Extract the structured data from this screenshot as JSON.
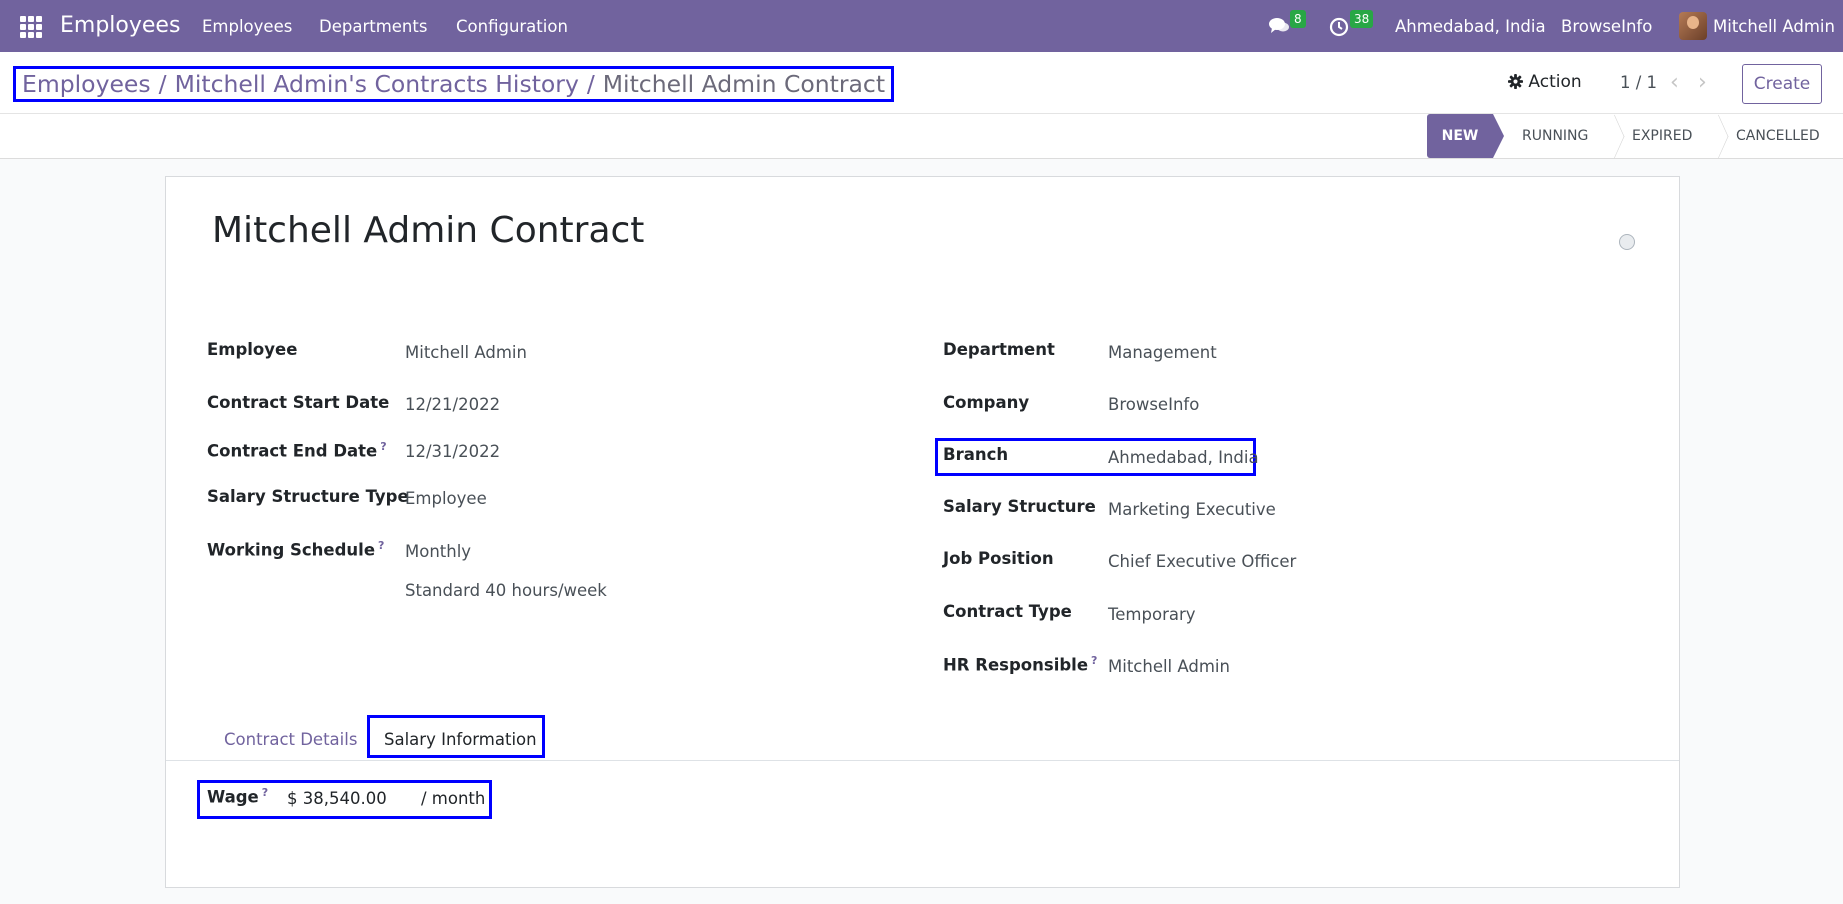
{
  "navbar": {
    "app_title": "Employees",
    "menu": [
      "Employees",
      "Departments",
      "Configuration"
    ],
    "messages_count": "8",
    "activities_count": "38",
    "branch": "Ahmedabad, India",
    "company": "BrowseInfo",
    "user": "Mitchell Admin",
    "icons": [
      "apps-grid-icon",
      "chat-icon",
      "clock-icon",
      "avatar"
    ]
  },
  "breadcrumb": {
    "items": [
      "Employees",
      "Mitchell Admin's Contracts History",
      "Mitchell Admin Contract"
    ],
    "separator": "/"
  },
  "control": {
    "action_label": "Action",
    "pager": "1 / 1",
    "create_label": "Create"
  },
  "stages": [
    "NEW",
    "RUNNING",
    "EXPIRED",
    "CANCELLED"
  ],
  "form": {
    "title": "Mitchell Admin Contract",
    "left": [
      {
        "label": "Employee",
        "value": "Mitchell Admin",
        "help": false
      },
      {
        "label": "Contract Start Date",
        "value": "12/21/2022",
        "help": false
      },
      {
        "label": "Contract End Date",
        "value": "12/31/2022",
        "help": true
      },
      {
        "label": "Salary Structure Type",
        "value": "Employee",
        "help": false
      },
      {
        "label": "Working Schedule",
        "value": "Monthly",
        "value2": "Standard 40 hours/week",
        "help": true
      }
    ],
    "right": [
      {
        "label": "Department",
        "value": "Management",
        "help": false
      },
      {
        "label": "Company",
        "value": "BrowseInfo",
        "help": false
      },
      {
        "label": "Branch",
        "value": "Ahmedabad, India",
        "help": false
      },
      {
        "label": "Salary Structure",
        "value": "Marketing Executive",
        "help": false
      },
      {
        "label": "Job Position",
        "value": "Chief Executive Officer",
        "help": false
      },
      {
        "label": "Contract Type",
        "value": "Temporary",
        "help": false
      },
      {
        "label": "HR Responsible",
        "value": "Mitchell Admin",
        "help": true
      }
    ],
    "help_mark": "?",
    "tabs": [
      "Contract Details",
      "Salary Information"
    ],
    "active_tab": "Salary Information",
    "wage": {
      "label": "Wage",
      "value": "$ 38,540.00",
      "unit": "/ month"
    }
  },
  "colors": {
    "brand": "#71639e",
    "highlight": "#0000ff",
    "badge": "#28a745"
  }
}
